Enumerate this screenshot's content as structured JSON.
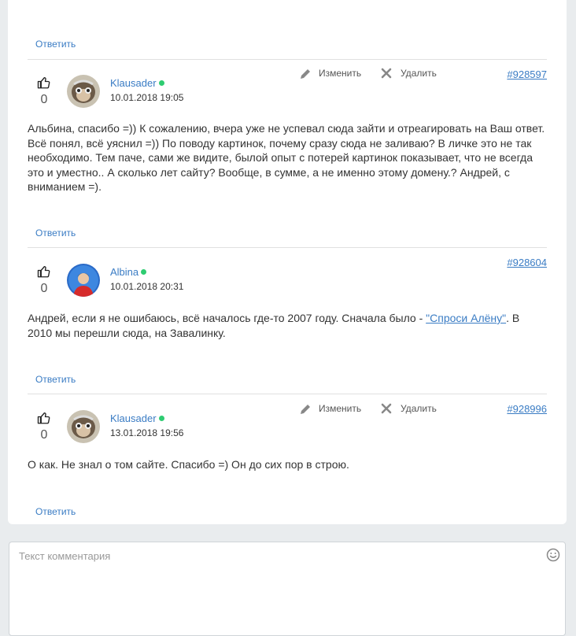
{
  "reply_label": "Ответить",
  "actions": {
    "edit": "Изменить",
    "delete": "Удалить"
  },
  "comments": [
    {
      "author": "Klausader",
      "date": "10.01.2018 19:05",
      "likes": "0",
      "id": "#928597",
      "text": "Альбина, спасибо =)) К сожалению, вчера уже не успевал сюда зайти и отреагировать на Ваш ответ. Всё понял, всё уяснил =)) По поводу картинок, почему сразу сюда не заливаю? В личке это не так необходимо. Тем паче, сами же видите, былой опыт с потерей картинок показывает, что не всегда это и уместно.. А сколько лет сайту? Вообще, в сумме, а не именно этому домену.? Андрей, с вниманием =)."
    },
    {
      "author": "Albina",
      "date": "10.01.2018 20:31",
      "likes": "0",
      "id": "#928604",
      "text_before": "Андрей, если я не ошибаюсь, всё началось где-то 2007 году. Сначала было - ",
      "link": "\"Спроси Алёну\"",
      "text_after": ". В 2010 мы перешли сюда, на Завалинку."
    },
    {
      "author": "Klausader",
      "date": "13.01.2018 19:56",
      "likes": "0",
      "id": "#928996",
      "text": "О как. Не знал о том сайте. Спасибо =) Он до сих пор в строю."
    }
  ],
  "comment_input": {
    "placeholder": "Текст комментария"
  },
  "colors": {
    "link": "#3a7cc4",
    "online": "#2ecc71",
    "background": "#e9ecee"
  }
}
